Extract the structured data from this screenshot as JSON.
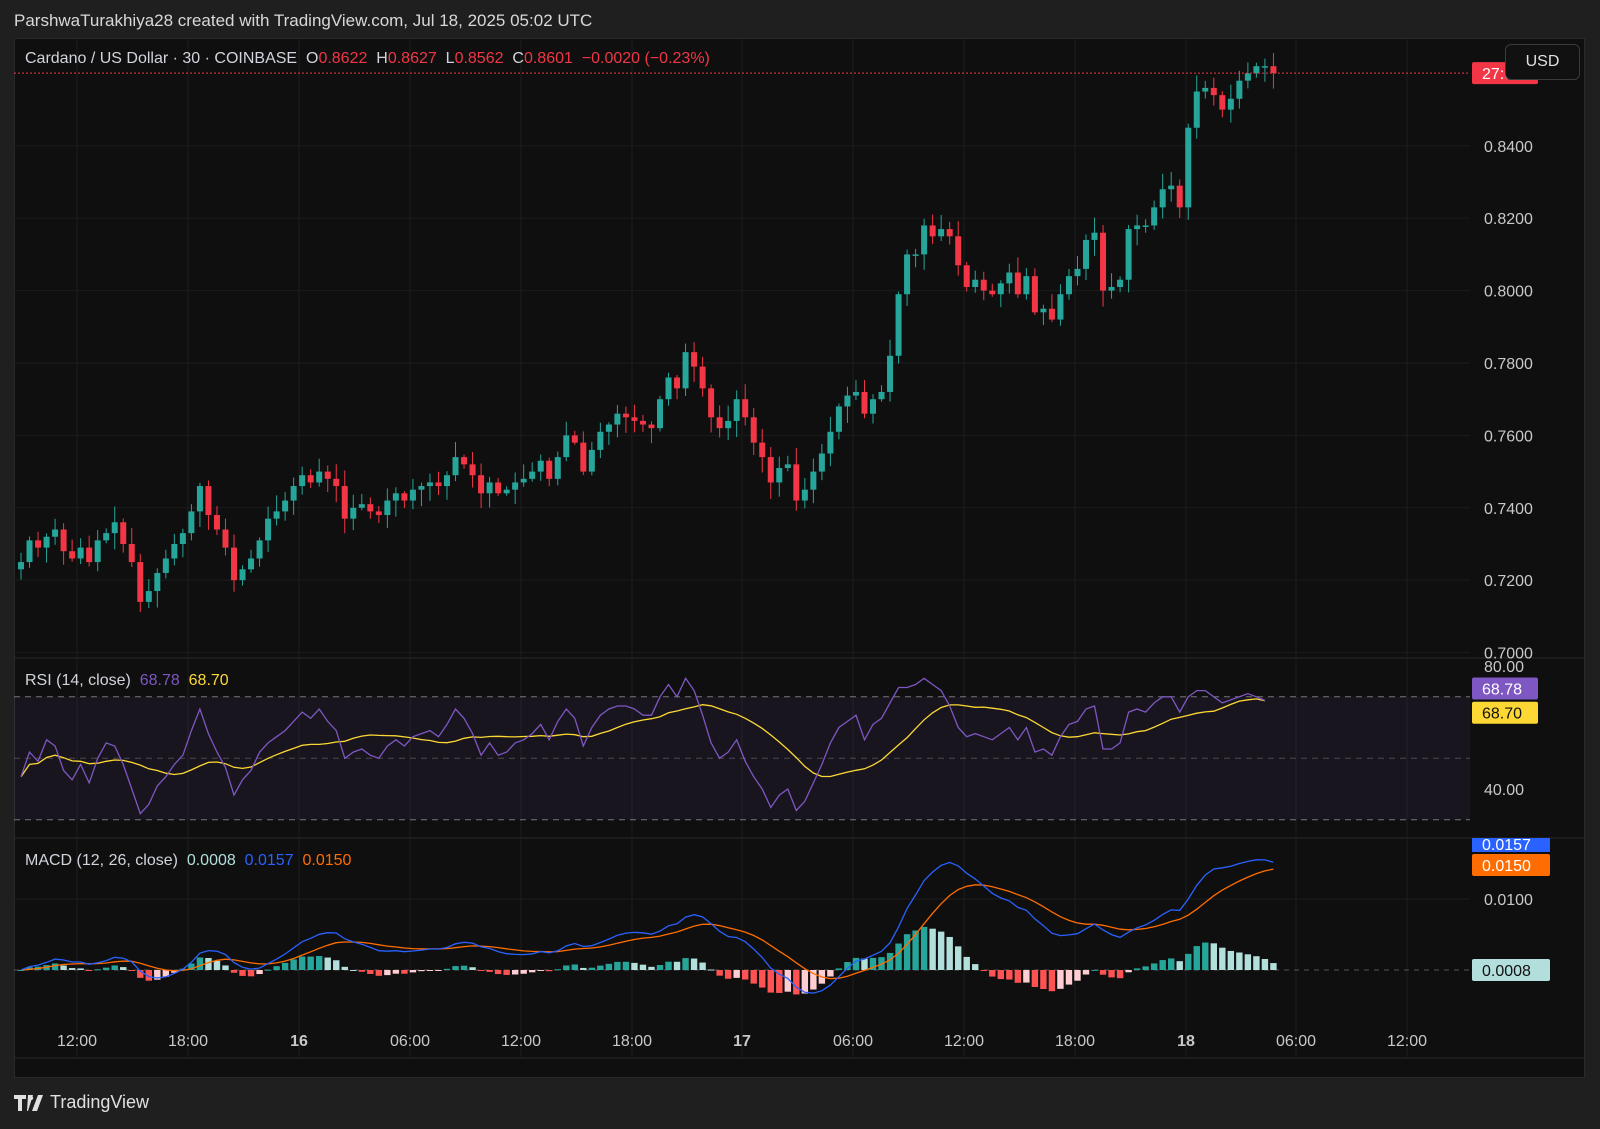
{
  "header": {
    "credit": "ParshwaTurakhiya28 created with TradingView.com, Jul 18, 2025 05:02 UTC"
  },
  "symbol_legend": {
    "name": "Cardano / US Dollar · 30 · COINBASE",
    "o_label": "O",
    "o_value": "0.8622",
    "h_label": "H",
    "h_value": "0.8627",
    "l_label": "L",
    "l_value": "0.8562",
    "c_label": "C",
    "c_value": "0.8601",
    "change": "−0.0020 (−0.23%)"
  },
  "currency_button": "USD",
  "rsi_legend": {
    "label": "RSI (14, close)",
    "rsi": "68.78",
    "ma": "68.70"
  },
  "macd_legend": {
    "label": "MACD (12, 26, close)",
    "hist": "0.0008",
    "macd": "0.0157",
    "signal": "0.0150"
  },
  "footer": {
    "brand": "TradingView"
  },
  "colors": {
    "up": "#26a69a",
    "down": "#f23645",
    "rsi": "#7e57c2",
    "rsi_ma": "#fdd835",
    "macd": "#2962ff",
    "signal": "#ff6d00",
    "hist_up_strong": "#26a69a",
    "hist_up_weak": "#b2dfdb",
    "hist_down_strong": "#ff5252",
    "hist_down_weak": "#ffcdd2"
  },
  "chart_data": [
    {
      "type": "candlestick",
      "title": "Cardano / US Dollar · 30 · COINBASE",
      "y_ticks": [
        "0.8400",
        "0.8200",
        "0.8000",
        "0.7800",
        "0.7600",
        "0.7400",
        "0.7200",
        "0.7000"
      ],
      "ylim": [
        0.6985,
        0.8615
      ],
      "x_ticks": [
        "12:00",
        "18:00",
        "16",
        "06:00",
        "12:00",
        "18:00",
        "17",
        "06:00",
        "12:00",
        "18:00",
        "18",
        "06:00",
        "12:00"
      ],
      "bold_x_ticks": [
        "16",
        "17",
        "18"
      ],
      "current_price_label": "27:05",
      "current_price": 0.8601,
      "candle_interval": "30 min",
      "closes": [
        0.725,
        0.731,
        0.729,
        0.732,
        0.734,
        0.728,
        0.726,
        0.729,
        0.725,
        0.731,
        0.733,
        0.736,
        0.73,
        0.725,
        0.714,
        0.717,
        0.722,
        0.726,
        0.73,
        0.733,
        0.739,
        0.746,
        0.738,
        0.734,
        0.729,
        0.72,
        0.723,
        0.726,
        0.731,
        0.737,
        0.739,
        0.742,
        0.746,
        0.749,
        0.747,
        0.75,
        0.748,
        0.746,
        0.737,
        0.74,
        0.741,
        0.739,
        0.738,
        0.742,
        0.744,
        0.742,
        0.745,
        0.746,
        0.747,
        0.746,
        0.749,
        0.754,
        0.752,
        0.749,
        0.744,
        0.747,
        0.744,
        0.745,
        0.747,
        0.748,
        0.75,
        0.753,
        0.748,
        0.754,
        0.76,
        0.758,
        0.75,
        0.756,
        0.761,
        0.763,
        0.766,
        0.765,
        0.764,
        0.763,
        0.762,
        0.77,
        0.776,
        0.773,
        0.783,
        0.779,
        0.773,
        0.765,
        0.762,
        0.764,
        0.77,
        0.765,
        0.758,
        0.754,
        0.747,
        0.751,
        0.752,
        0.742,
        0.745,
        0.75,
        0.755,
        0.761,
        0.768,
        0.771,
        0.772,
        0.766,
        0.77,
        0.772,
        0.782,
        0.799,
        0.81,
        0.81,
        0.818,
        0.815,
        0.817,
        0.815,
        0.807,
        0.801,
        0.803,
        0.8,
        0.799,
        0.802,
        0.805,
        0.799,
        0.804,
        0.794,
        0.795,
        0.792,
        0.799,
        0.804,
        0.806,
        0.814,
        0.816,
        0.8,
        0.801,
        0.803,
        0.817,
        0.818,
        0.818,
        0.823,
        0.828,
        0.829,
        0.823,
        0.845,
        0.855,
        0.856,
        0.854,
        0.85,
        0.853,
        0.858,
        0.86,
        0.862,
        0.862,
        0.8601
      ]
    },
    {
      "type": "line",
      "title": "RSI (14, close)",
      "y_ticks": [
        "80.00",
        "40.00"
      ],
      "bands": [
        70,
        50,
        30
      ],
      "series": [
        {
          "name": "RSI",
          "last": 68.78
        },
        {
          "name": "RSI MA",
          "last": 68.7
        }
      ],
      "rsi_values": [
        44,
        52,
        49,
        56,
        54,
        46,
        43,
        48,
        42,
        50,
        55,
        54,
        48,
        40,
        32,
        35,
        41,
        44,
        48,
        51,
        59,
        66,
        58,
        52,
        47,
        38,
        43,
        46,
        52,
        55,
        57,
        59,
        62,
        65,
        63,
        66,
        62,
        59,
        50,
        52,
        53,
        51,
        50,
        54,
        56,
        54,
        57,
        58,
        59,
        57,
        61,
        66,
        63,
        58,
        51,
        55,
        51,
        52,
        55,
        56,
        58,
        61,
        56,
        62,
        66,
        63,
        54,
        60,
        64,
        66,
        67,
        67,
        66,
        64,
        64,
        70,
        74,
        70,
        76,
        72,
        64,
        55,
        50,
        52,
        56,
        49,
        44,
        40,
        34,
        38,
        40,
        33,
        36,
        42,
        48,
        55,
        60,
        62,
        64,
        56,
        61,
        63,
        68,
        73,
        73,
        74,
        76,
        74,
        72,
        67,
        60,
        57,
        58,
        57,
        56,
        58,
        60,
        56,
        60,
        52,
        53,
        51,
        57,
        61,
        62,
        66,
        67,
        53,
        53,
        55,
        65,
        66,
        65,
        68,
        70,
        70,
        65,
        70,
        72,
        72,
        70,
        68,
        69,
        70,
        71,
        70,
        68.78
      ]
    },
    {
      "type": "line",
      "title": "MACD (12, 26, close)",
      "y_ticks": [
        "0.0157",
        "0.0150",
        "0.0100",
        "0.0008"
      ],
      "series": [
        {
          "name": "MACD",
          "last": 0.0157
        },
        {
          "name": "Signal",
          "last": 0.015
        },
        {
          "name": "Histogram",
          "last": 0.0008
        }
      ]
    }
  ]
}
